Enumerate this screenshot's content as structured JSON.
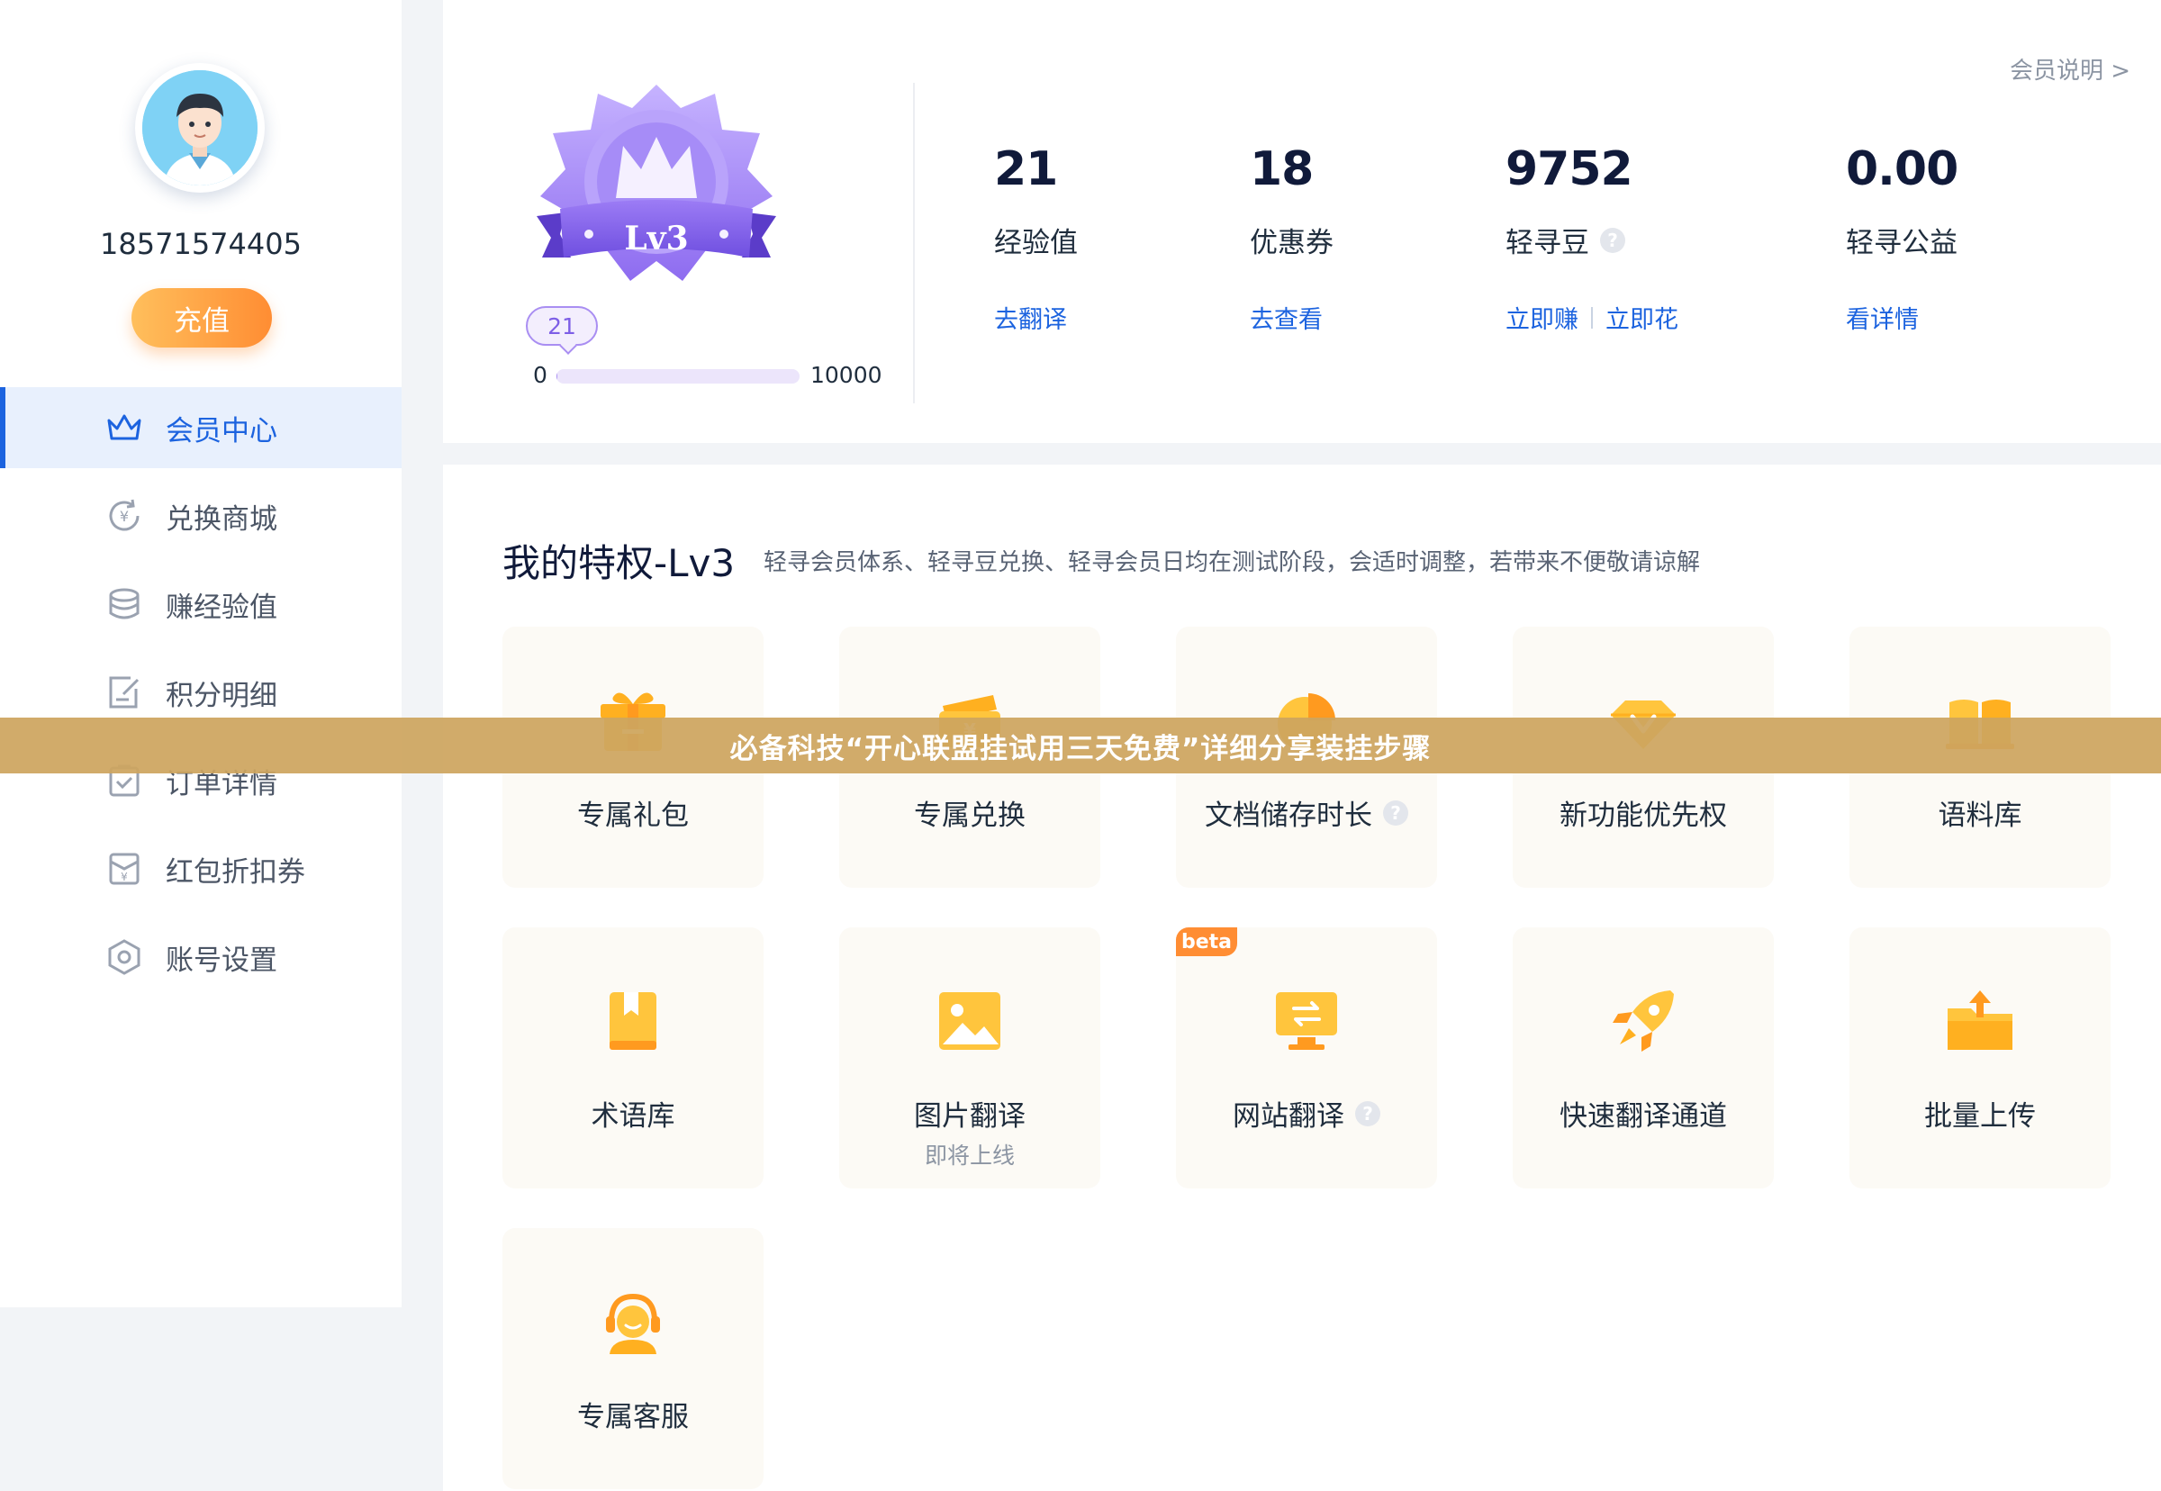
{
  "colors": {
    "accent_blue": "#1c63df",
    "recharge_orange": "#ff8d33",
    "level_purple": "#a98ef2",
    "card_bg": "#fcfaf5",
    "banner_bg": "#cda55f"
  },
  "sidebar": {
    "phone": "18571574405",
    "recharge_label": "充值",
    "items": [
      {
        "label": "会员中心",
        "icon": "crown-icon",
        "active": true
      },
      {
        "label": "兑换商城",
        "icon": "exchange-icon",
        "active": false
      },
      {
        "label": "赚经验值",
        "icon": "coin-stack-icon",
        "active": false
      },
      {
        "label": "积分明细",
        "icon": "edit-document-icon",
        "active": false
      },
      {
        "label": "订单详情",
        "icon": "clipboard-check-icon",
        "active": false
      },
      {
        "label": "红包折扣券",
        "icon": "red-envelope-icon",
        "active": false
      },
      {
        "label": "账号设置",
        "icon": "settings-hexagon-icon",
        "active": false
      }
    ]
  },
  "top": {
    "member_info_link": "会员说明 >",
    "badge_level": "Lv3",
    "level": {
      "current": "21",
      "min": "0",
      "max": "10000",
      "progress_fraction": 0.0021
    },
    "stats": [
      {
        "value": "21",
        "label": "经验值",
        "links": [
          "去翻译"
        ],
        "help": false
      },
      {
        "value": "18",
        "label": "优惠券",
        "links": [
          "去查看"
        ],
        "help": false
      },
      {
        "value": "9752",
        "label": "轻寻豆",
        "links": [
          "立即赚",
          "立即花"
        ],
        "help": true
      },
      {
        "value": "0.00",
        "label": "轻寻公益",
        "links": [
          "看详情"
        ],
        "help": false
      }
    ]
  },
  "privileges": {
    "title": "我的特权-Lv3",
    "subtitle": "轻寻会员体系、轻寻豆兑换、轻寻会员日均在测试阶段，会适时调整，若带来不便敬请谅解",
    "cards": [
      {
        "label": "专属礼包",
        "icon": "gift-icon"
      },
      {
        "label": "专属兑换",
        "icon": "ticket-icon"
      },
      {
        "label": "文档储存时长",
        "icon": "pie-chart-icon",
        "help": true
      },
      {
        "label": "新功能优先权",
        "icon": "diamond-icon"
      },
      {
        "label": "语料库",
        "icon": "open-book-icon"
      },
      {
        "label": "术语库",
        "icon": "bookmark-book-icon"
      },
      {
        "label": "图片翻译",
        "icon": "image-icon",
        "note": "即将上线"
      },
      {
        "label": "网站翻译",
        "icon": "monitor-icon",
        "help": true,
        "tag": "beta"
      },
      {
        "label": "快速翻译通道",
        "icon": "rocket-icon"
      },
      {
        "label": "批量上传",
        "icon": "folder-upload-icon"
      },
      {
        "label": "专属客服",
        "icon": "headset-icon"
      }
    ]
  },
  "banner": {
    "text": "必备科技“开心联盟挂试用三天免费”详细分享装挂步骤"
  }
}
